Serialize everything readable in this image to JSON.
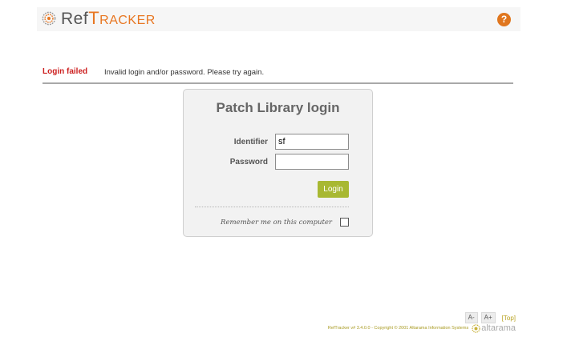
{
  "header": {
    "logo_ref": "Ref",
    "logo_t": "T",
    "logo_rest": "RACKER",
    "help_icon_text": "?",
    "accent_color": "#e87722"
  },
  "message": {
    "title": "Login failed",
    "text": "Invalid login and/or password. Please try again.",
    "title_color": "#cc1f1f"
  },
  "login": {
    "title": "Patch Library login",
    "identifier_label": "Identifier",
    "identifier_value": "sf",
    "password_label": "Password",
    "password_value": "",
    "button_label": "Login",
    "button_color": "#a8b832",
    "remember_label": "Remember me on this computer",
    "remember_checked": false
  },
  "footer": {
    "font_decrease": "A-",
    "font_increase": "A+",
    "top_link": "[Top]",
    "copyright": "RefTracker v# 3.4.0.0 - Copyright © 2001 Altarama Information Systems",
    "brand": "altarama"
  }
}
